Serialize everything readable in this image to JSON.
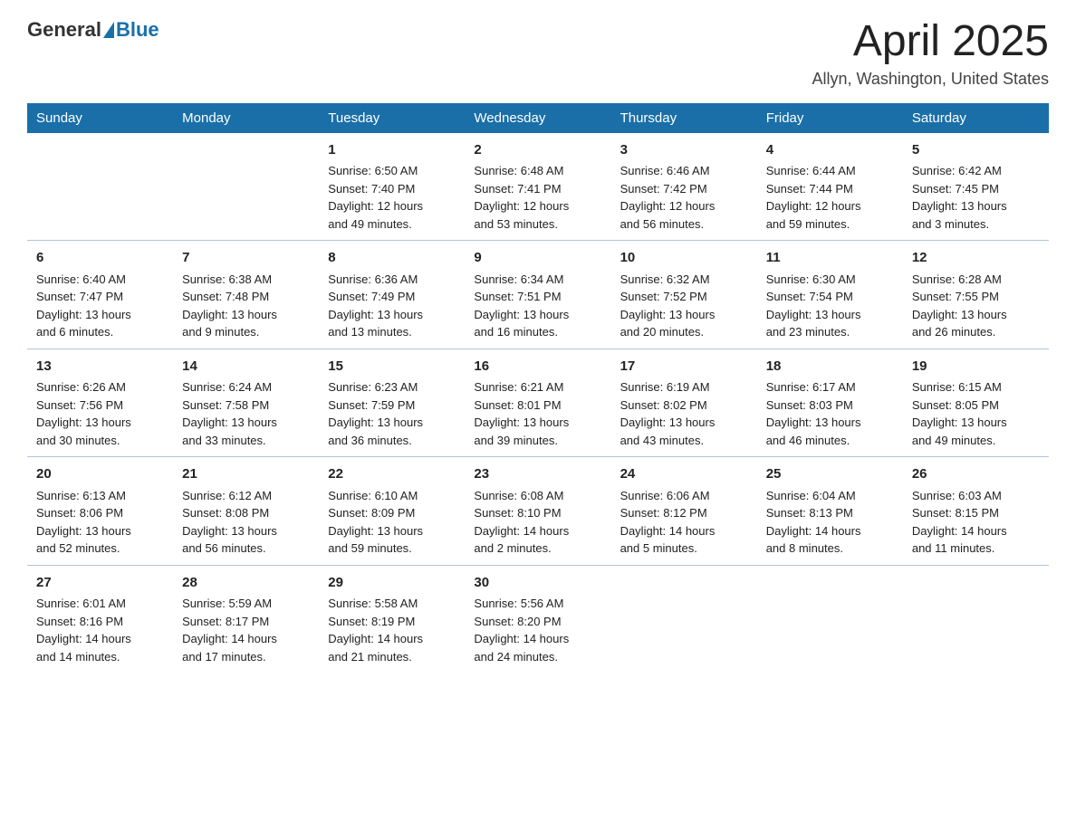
{
  "header": {
    "logo_general": "General",
    "logo_blue": "Blue",
    "title": "April 2025",
    "location": "Allyn, Washington, United States"
  },
  "weekdays": [
    "Sunday",
    "Monday",
    "Tuesday",
    "Wednesday",
    "Thursday",
    "Friday",
    "Saturday"
  ],
  "weeks": [
    [
      {
        "day": "",
        "info": ""
      },
      {
        "day": "",
        "info": ""
      },
      {
        "day": "1",
        "info": "Sunrise: 6:50 AM\nSunset: 7:40 PM\nDaylight: 12 hours\nand 49 minutes."
      },
      {
        "day": "2",
        "info": "Sunrise: 6:48 AM\nSunset: 7:41 PM\nDaylight: 12 hours\nand 53 minutes."
      },
      {
        "day": "3",
        "info": "Sunrise: 6:46 AM\nSunset: 7:42 PM\nDaylight: 12 hours\nand 56 minutes."
      },
      {
        "day": "4",
        "info": "Sunrise: 6:44 AM\nSunset: 7:44 PM\nDaylight: 12 hours\nand 59 minutes."
      },
      {
        "day": "5",
        "info": "Sunrise: 6:42 AM\nSunset: 7:45 PM\nDaylight: 13 hours\nand 3 minutes."
      }
    ],
    [
      {
        "day": "6",
        "info": "Sunrise: 6:40 AM\nSunset: 7:47 PM\nDaylight: 13 hours\nand 6 minutes."
      },
      {
        "day": "7",
        "info": "Sunrise: 6:38 AM\nSunset: 7:48 PM\nDaylight: 13 hours\nand 9 minutes."
      },
      {
        "day": "8",
        "info": "Sunrise: 6:36 AM\nSunset: 7:49 PM\nDaylight: 13 hours\nand 13 minutes."
      },
      {
        "day": "9",
        "info": "Sunrise: 6:34 AM\nSunset: 7:51 PM\nDaylight: 13 hours\nand 16 minutes."
      },
      {
        "day": "10",
        "info": "Sunrise: 6:32 AM\nSunset: 7:52 PM\nDaylight: 13 hours\nand 20 minutes."
      },
      {
        "day": "11",
        "info": "Sunrise: 6:30 AM\nSunset: 7:54 PM\nDaylight: 13 hours\nand 23 minutes."
      },
      {
        "day": "12",
        "info": "Sunrise: 6:28 AM\nSunset: 7:55 PM\nDaylight: 13 hours\nand 26 minutes."
      }
    ],
    [
      {
        "day": "13",
        "info": "Sunrise: 6:26 AM\nSunset: 7:56 PM\nDaylight: 13 hours\nand 30 minutes."
      },
      {
        "day": "14",
        "info": "Sunrise: 6:24 AM\nSunset: 7:58 PM\nDaylight: 13 hours\nand 33 minutes."
      },
      {
        "day": "15",
        "info": "Sunrise: 6:23 AM\nSunset: 7:59 PM\nDaylight: 13 hours\nand 36 minutes."
      },
      {
        "day": "16",
        "info": "Sunrise: 6:21 AM\nSunset: 8:01 PM\nDaylight: 13 hours\nand 39 minutes."
      },
      {
        "day": "17",
        "info": "Sunrise: 6:19 AM\nSunset: 8:02 PM\nDaylight: 13 hours\nand 43 minutes."
      },
      {
        "day": "18",
        "info": "Sunrise: 6:17 AM\nSunset: 8:03 PM\nDaylight: 13 hours\nand 46 minutes."
      },
      {
        "day": "19",
        "info": "Sunrise: 6:15 AM\nSunset: 8:05 PM\nDaylight: 13 hours\nand 49 minutes."
      }
    ],
    [
      {
        "day": "20",
        "info": "Sunrise: 6:13 AM\nSunset: 8:06 PM\nDaylight: 13 hours\nand 52 minutes."
      },
      {
        "day": "21",
        "info": "Sunrise: 6:12 AM\nSunset: 8:08 PM\nDaylight: 13 hours\nand 56 minutes."
      },
      {
        "day": "22",
        "info": "Sunrise: 6:10 AM\nSunset: 8:09 PM\nDaylight: 13 hours\nand 59 minutes."
      },
      {
        "day": "23",
        "info": "Sunrise: 6:08 AM\nSunset: 8:10 PM\nDaylight: 14 hours\nand 2 minutes."
      },
      {
        "day": "24",
        "info": "Sunrise: 6:06 AM\nSunset: 8:12 PM\nDaylight: 14 hours\nand 5 minutes."
      },
      {
        "day": "25",
        "info": "Sunrise: 6:04 AM\nSunset: 8:13 PM\nDaylight: 14 hours\nand 8 minutes."
      },
      {
        "day": "26",
        "info": "Sunrise: 6:03 AM\nSunset: 8:15 PM\nDaylight: 14 hours\nand 11 minutes."
      }
    ],
    [
      {
        "day": "27",
        "info": "Sunrise: 6:01 AM\nSunset: 8:16 PM\nDaylight: 14 hours\nand 14 minutes."
      },
      {
        "day": "28",
        "info": "Sunrise: 5:59 AM\nSunset: 8:17 PM\nDaylight: 14 hours\nand 17 minutes."
      },
      {
        "day": "29",
        "info": "Sunrise: 5:58 AM\nSunset: 8:19 PM\nDaylight: 14 hours\nand 21 minutes."
      },
      {
        "day": "30",
        "info": "Sunrise: 5:56 AM\nSunset: 8:20 PM\nDaylight: 14 hours\nand 24 minutes."
      },
      {
        "day": "",
        "info": ""
      },
      {
        "day": "",
        "info": ""
      },
      {
        "day": "",
        "info": ""
      }
    ]
  ]
}
